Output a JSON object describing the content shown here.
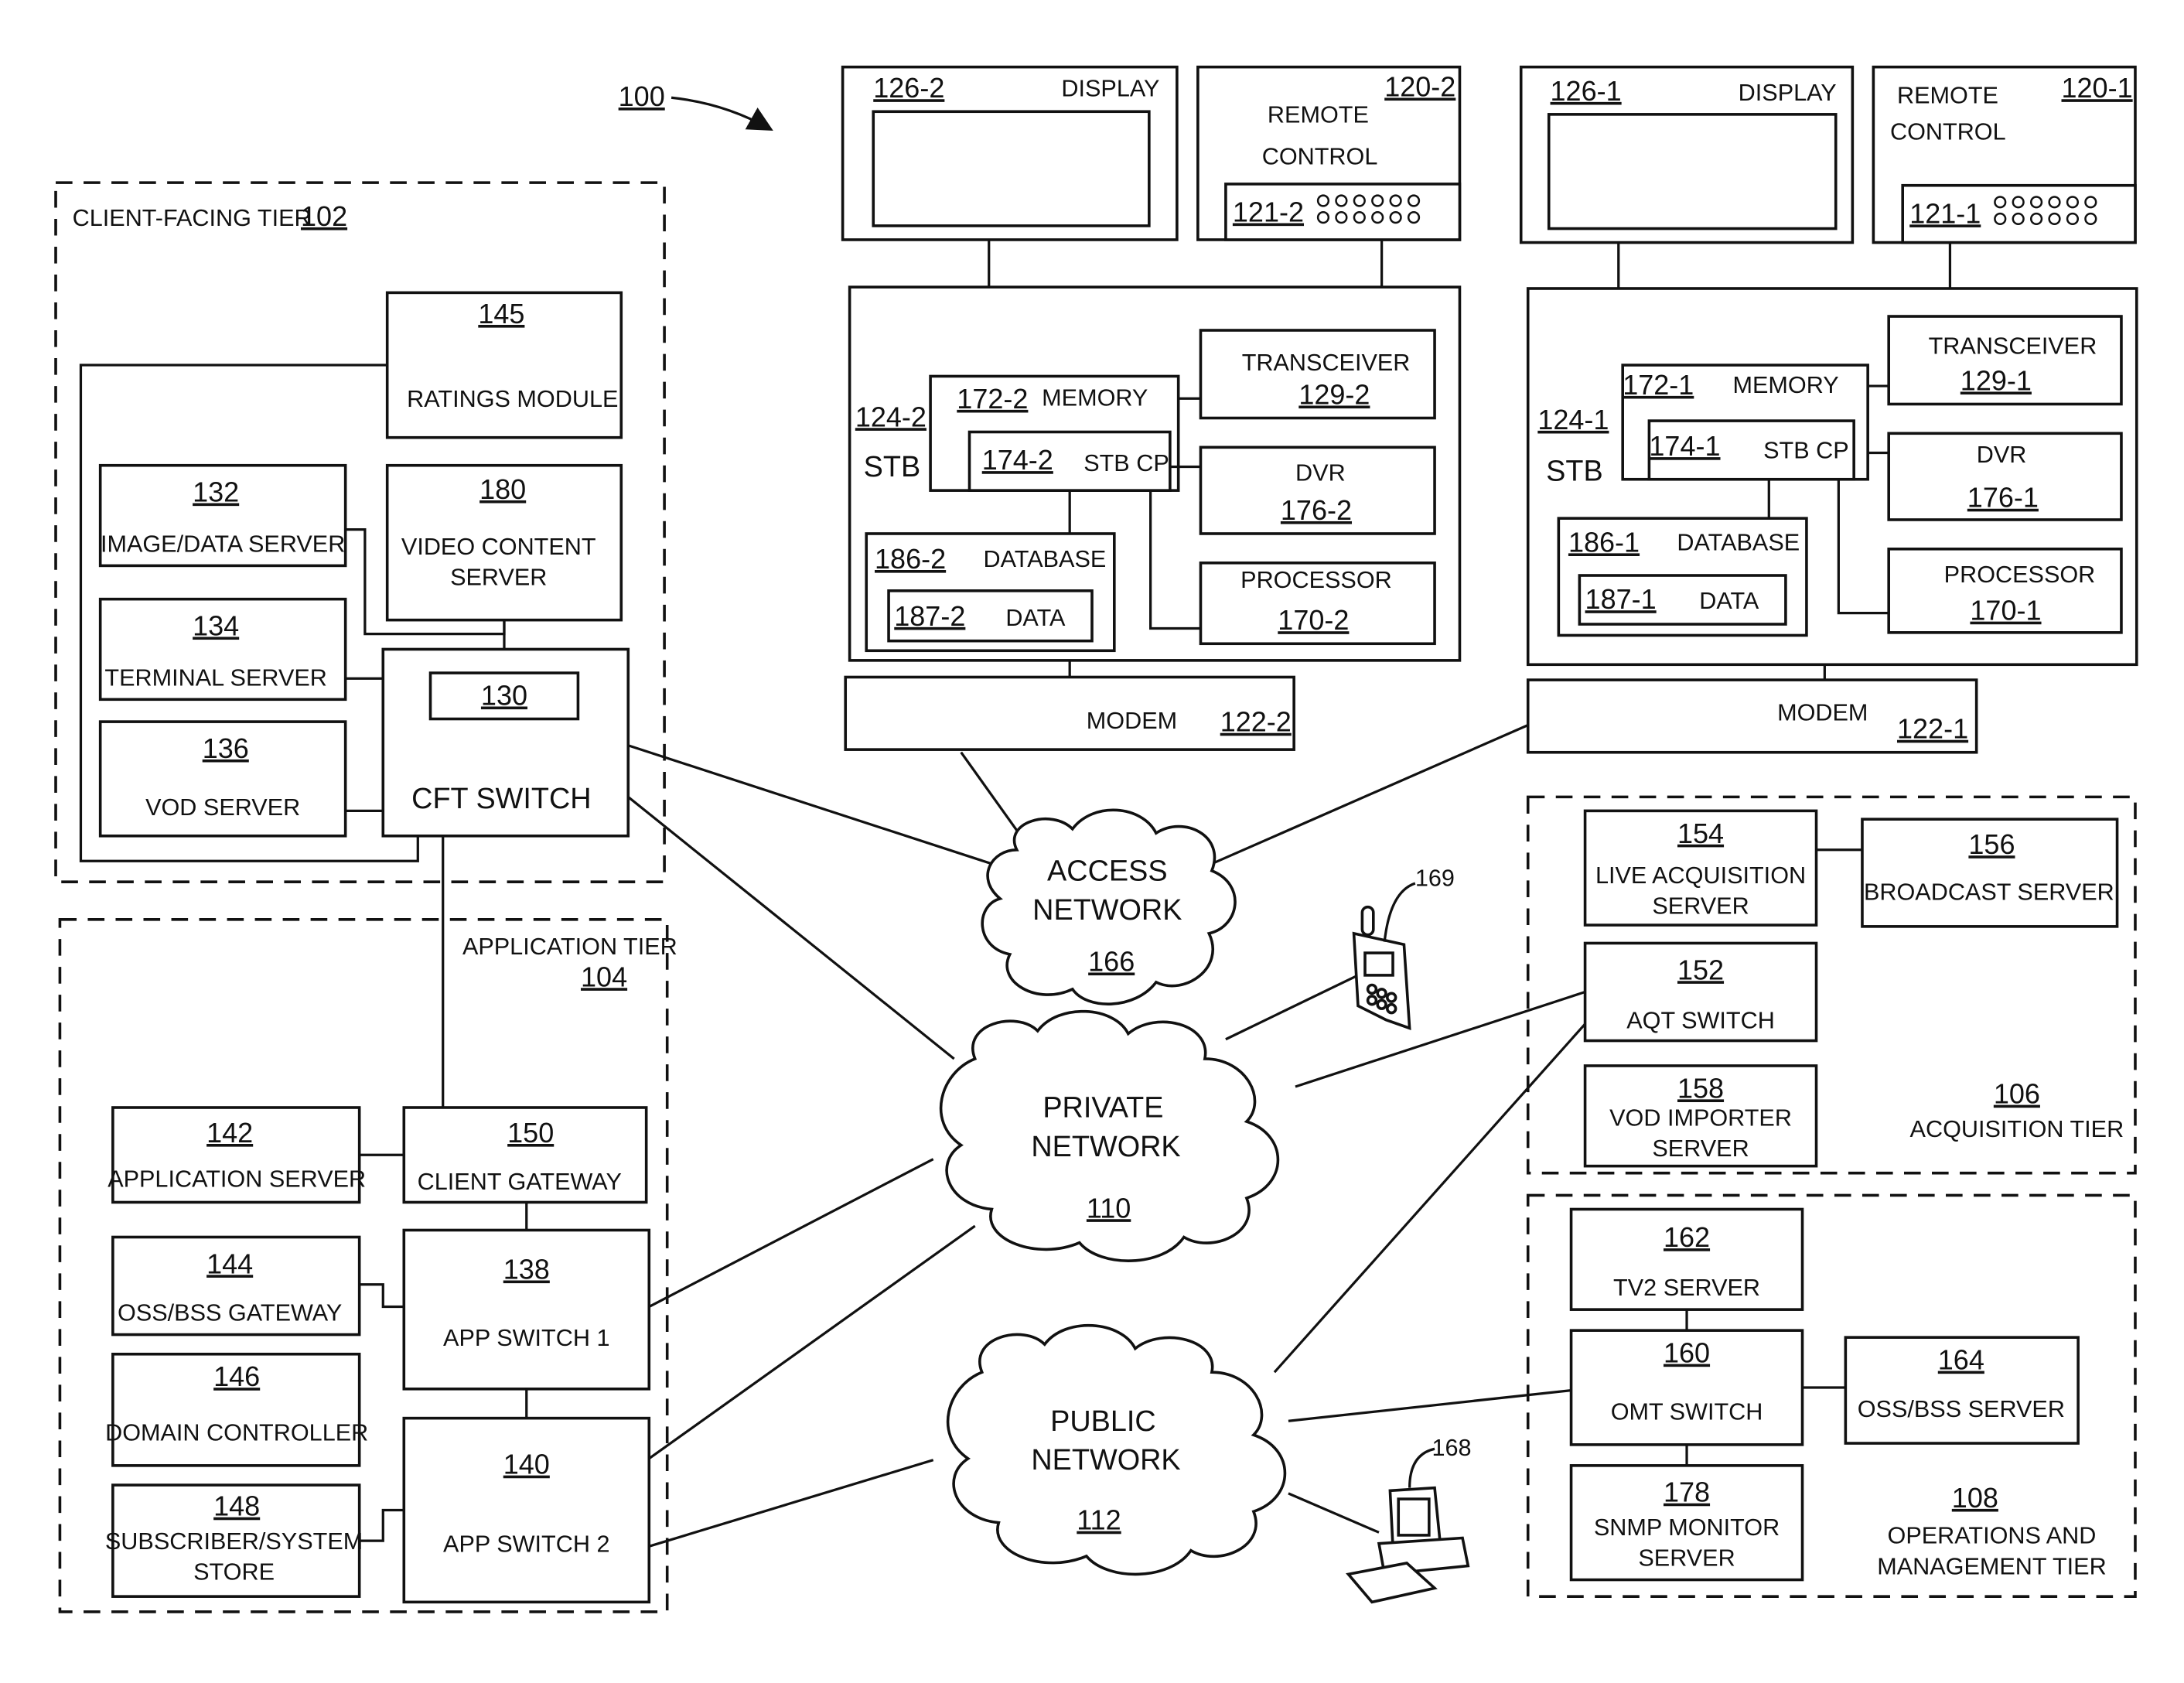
{
  "figure_ref": "100",
  "tiers": {
    "client_facing": {
      "label": "CLIENT-FACING TIER",
      "num": "102"
    },
    "application": {
      "label": "APPLICATION TIER",
      "num": "104"
    },
    "acquisition": {
      "label": "ACQUISITION TIER",
      "num": "106"
    },
    "operations": {
      "label1": "OPERATIONS AND",
      "label2": "MANAGEMENT TIER",
      "num": "108"
    }
  },
  "nodes": {
    "ratings": {
      "num": "145",
      "label": "RATINGS MODULE"
    },
    "image_server": {
      "num": "132",
      "label": "IMAGE/DATA SERVER"
    },
    "video_server": {
      "num": "180",
      "label1": "VIDEO CONTENT",
      "label2": "SERVER"
    },
    "terminal_server": {
      "num": "134",
      "label": "TERMINAL SERVER"
    },
    "cft_switch": {
      "num": "130",
      "label": "CFT SWITCH"
    },
    "vod_server": {
      "num": "136",
      "label": "VOD SERVER"
    },
    "app_server": {
      "num": "142",
      "label": "APPLICATION SERVER"
    },
    "client_gateway": {
      "num": "150",
      "label": "CLIENT GATEWAY"
    },
    "oss_gateway": {
      "num": "144",
      "label": "OSS/BSS GATEWAY"
    },
    "app_switch1": {
      "num": "138",
      "label": "APP SWITCH 1"
    },
    "domain_controller": {
      "num": "146",
      "label": "DOMAIN CONTROLLER"
    },
    "app_switch2": {
      "num": "140",
      "label": "APP SWITCH 2"
    },
    "subscriber_store": {
      "num": "148",
      "label1": "SUBSCRIBER/SYSTEM",
      "label2": "STORE"
    },
    "live_acq": {
      "num": "154",
      "label1": "LIVE ACQUISITION",
      "label2": "SERVER"
    },
    "broadcast": {
      "num": "156",
      "label": "BROADCAST SERVER"
    },
    "aqt_switch": {
      "num": "152",
      "label": "AQT SWITCH"
    },
    "vod_importer": {
      "num": "158",
      "label1": "VOD IMPORTER",
      "label2": "SERVER"
    },
    "tv2_server": {
      "num": "162",
      "label": "TV2 SERVER"
    },
    "omt_switch": {
      "num": "160",
      "label": "OMT SWITCH"
    },
    "oss_server": {
      "num": "164",
      "label": "OSS/BSS SERVER"
    },
    "snmp": {
      "num": "178",
      "label1": "SNMP MONITOR",
      "label2": "SERVER"
    }
  },
  "networks": {
    "access": {
      "label1": "ACCESS",
      "label2": "NETWORK",
      "num": "166"
    },
    "private": {
      "label1": "PRIVATE",
      "label2": "NETWORK",
      "num": "110"
    },
    "public": {
      "label1": "PUBLIC",
      "label2": "NETWORK",
      "num": "112"
    }
  },
  "devices": {
    "phone": "169",
    "computer": "168"
  },
  "premises": [
    {
      "display": {
        "num": "126-2",
        "label": "DISPLAY"
      },
      "remote": {
        "num": "120-2",
        "label1": "REMOTE",
        "label2": "CONTROL",
        "keypad": "121-2"
      },
      "stb": {
        "num": "124-2",
        "label": "STB"
      },
      "memory": {
        "num": "172-2",
        "label": "MEMORY"
      },
      "stbcp": {
        "num": "174-2",
        "label": "STB CP"
      },
      "transceiver": {
        "num": "129-2",
        "label": "TRANSCEIVER"
      },
      "dvr": {
        "num": "176-2",
        "label": "DVR"
      },
      "processor": {
        "num": "170-2",
        "label": "PROCESSOR"
      },
      "database": {
        "num": "186-2",
        "label": "DATABASE"
      },
      "data": {
        "num": "187-2",
        "label": "DATA"
      },
      "modem": {
        "num": "122-2",
        "label": "MODEM"
      }
    },
    {
      "display": {
        "num": "126-1",
        "label": "DISPLAY"
      },
      "remote": {
        "num": "120-1",
        "label1": "REMOTE",
        "label2": "CONTROL",
        "keypad": "121-1"
      },
      "stb": {
        "num": "124-1",
        "label": "STB"
      },
      "memory": {
        "num": "172-1",
        "label": "MEMORY"
      },
      "stbcp": {
        "num": "174-1",
        "label": "STB CP"
      },
      "transceiver": {
        "num": "129-1",
        "label": "TRANSCEIVER"
      },
      "dvr": {
        "num": "176-1",
        "label": "DVR"
      },
      "processor": {
        "num": "170-1",
        "label": "PROCESSOR"
      },
      "database": {
        "num": "186-1",
        "label": "DATABASE"
      },
      "data": {
        "num": "187-1",
        "label": "DATA"
      },
      "modem": {
        "num": "122-1",
        "label": "MODEM"
      }
    }
  ]
}
